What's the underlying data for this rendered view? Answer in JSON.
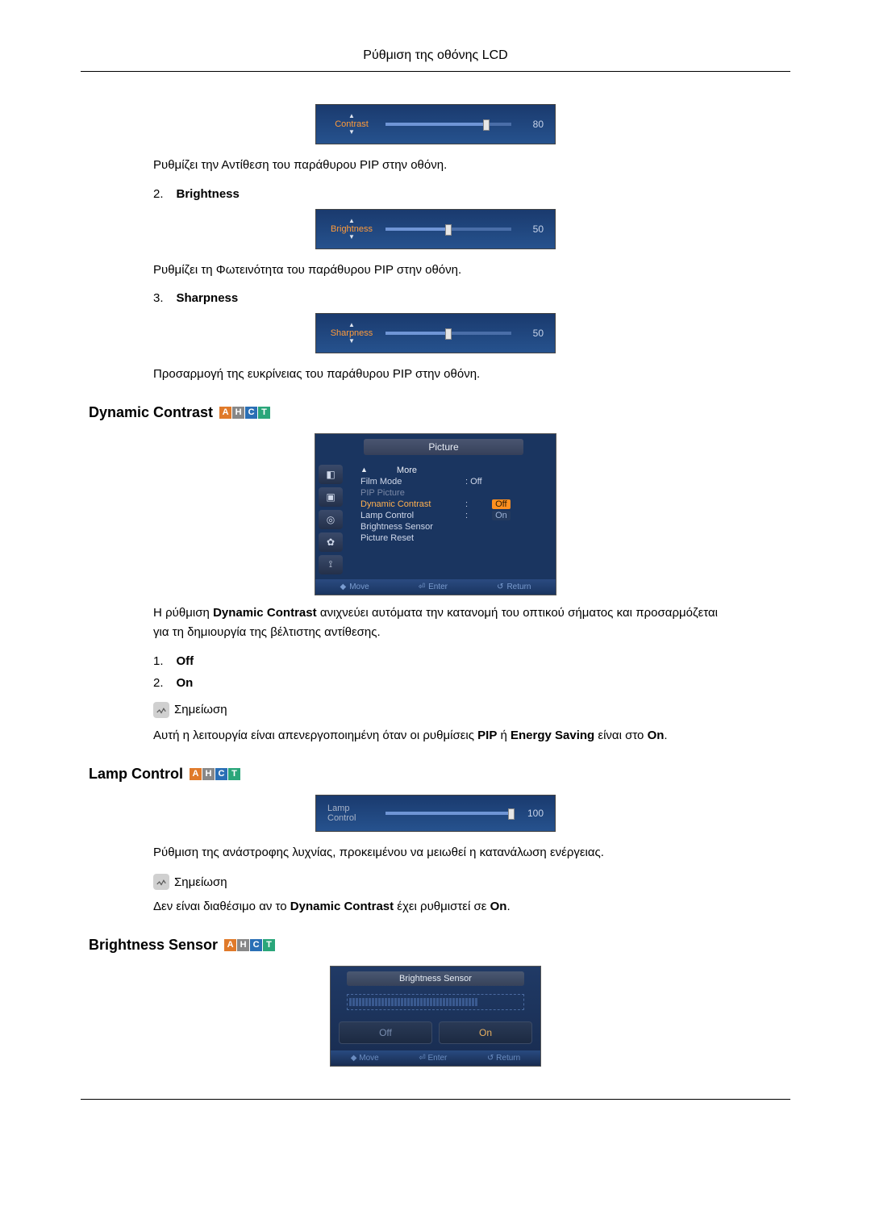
{
  "headerTitle": "Ρύθμιση της οθόνης LCD",
  "contrastSlider": {
    "label": "Contrast",
    "value": "80",
    "pct": "80%"
  },
  "contrastDesc": "Ρυθμίζει την Αντίθεση του παράθυρου PIP στην οθόνη.",
  "items": [
    {
      "num": "2.",
      "label": "Brightness"
    },
    {
      "num": "3.",
      "label": "Sharpness"
    }
  ],
  "brightnessSlider": {
    "label": "Brightness",
    "value": "50",
    "pct": "50%"
  },
  "brightnessDesc": "Ρυθμίζει τη Φωτεινότητα του παράθυρου PIP στην οθόνη.",
  "sharpnessSlider": {
    "label": "Sharpness",
    "value": "50",
    "pct": "50%"
  },
  "sharpnessDesc": "Προσαρμογή της ευκρίνειας του παράθυρου PIP στην οθόνη.",
  "dynContrast": {
    "heading": "Dynamic Contrast",
    "menuTitle": "Picture",
    "more": "More",
    "rows": [
      {
        "label": "Film Mode",
        "value": ": Off",
        "mode": "normal"
      },
      {
        "label": "PIP Picture",
        "value": "",
        "mode": "gray"
      },
      {
        "label": "Dynamic Contrast",
        "value": "Off",
        "mode": "sel"
      },
      {
        "label": "Lamp Control",
        "value": "On",
        "mode": "on"
      },
      {
        "label": "Brightness Sensor",
        "value": "",
        "mode": "normal"
      },
      {
        "label": "Picture Reset",
        "value": "",
        "mode": "normal"
      }
    ],
    "footer": {
      "move": "Move",
      "enter": "Enter",
      "ret": "Return"
    },
    "desc": "Η ρύθμιση Dynamic Contrast ανιχνεύει αυτόματα την κατανομή του οπτικού σήματος και προσαρμόζεται για τη δημιουργία της βέλτιστης αντίθεσης.",
    "opts": [
      {
        "num": "1.",
        "label": "Off"
      },
      {
        "num": "2.",
        "label": "On"
      }
    ],
    "noteLabel": "Σημείωση",
    "noteText": "Αυτή η λειτουργία είναι απενεργοποιημένη όταν οι ρυθμίσεις PIP ή Energy Saving είναι στο On."
  },
  "lampControl": {
    "heading": "Lamp Control",
    "slider": {
      "label": "Lamp Control",
      "value": "100",
      "pct": "100%"
    },
    "desc": "Ρύθμιση της ανάστροφης λυχνίας, προκειμένου να μειωθεί η κατανάλωση ενέργειας.",
    "noteLabel": "Σημείωση",
    "noteText": "Δεν είναι διαθέσιμο αν το Dynamic Contrast έχει ρυθμιστεί σε On."
  },
  "brightnessSensor": {
    "heading": "Brightness Sensor",
    "panelTitle": "Brightness Sensor",
    "off": "Off",
    "on": "On",
    "footer": {
      "move": "Move",
      "enter": "Enter",
      "ret": "Return"
    }
  },
  "badges": {
    "a": "A",
    "h": "H",
    "c": "C",
    "t": "T"
  }
}
